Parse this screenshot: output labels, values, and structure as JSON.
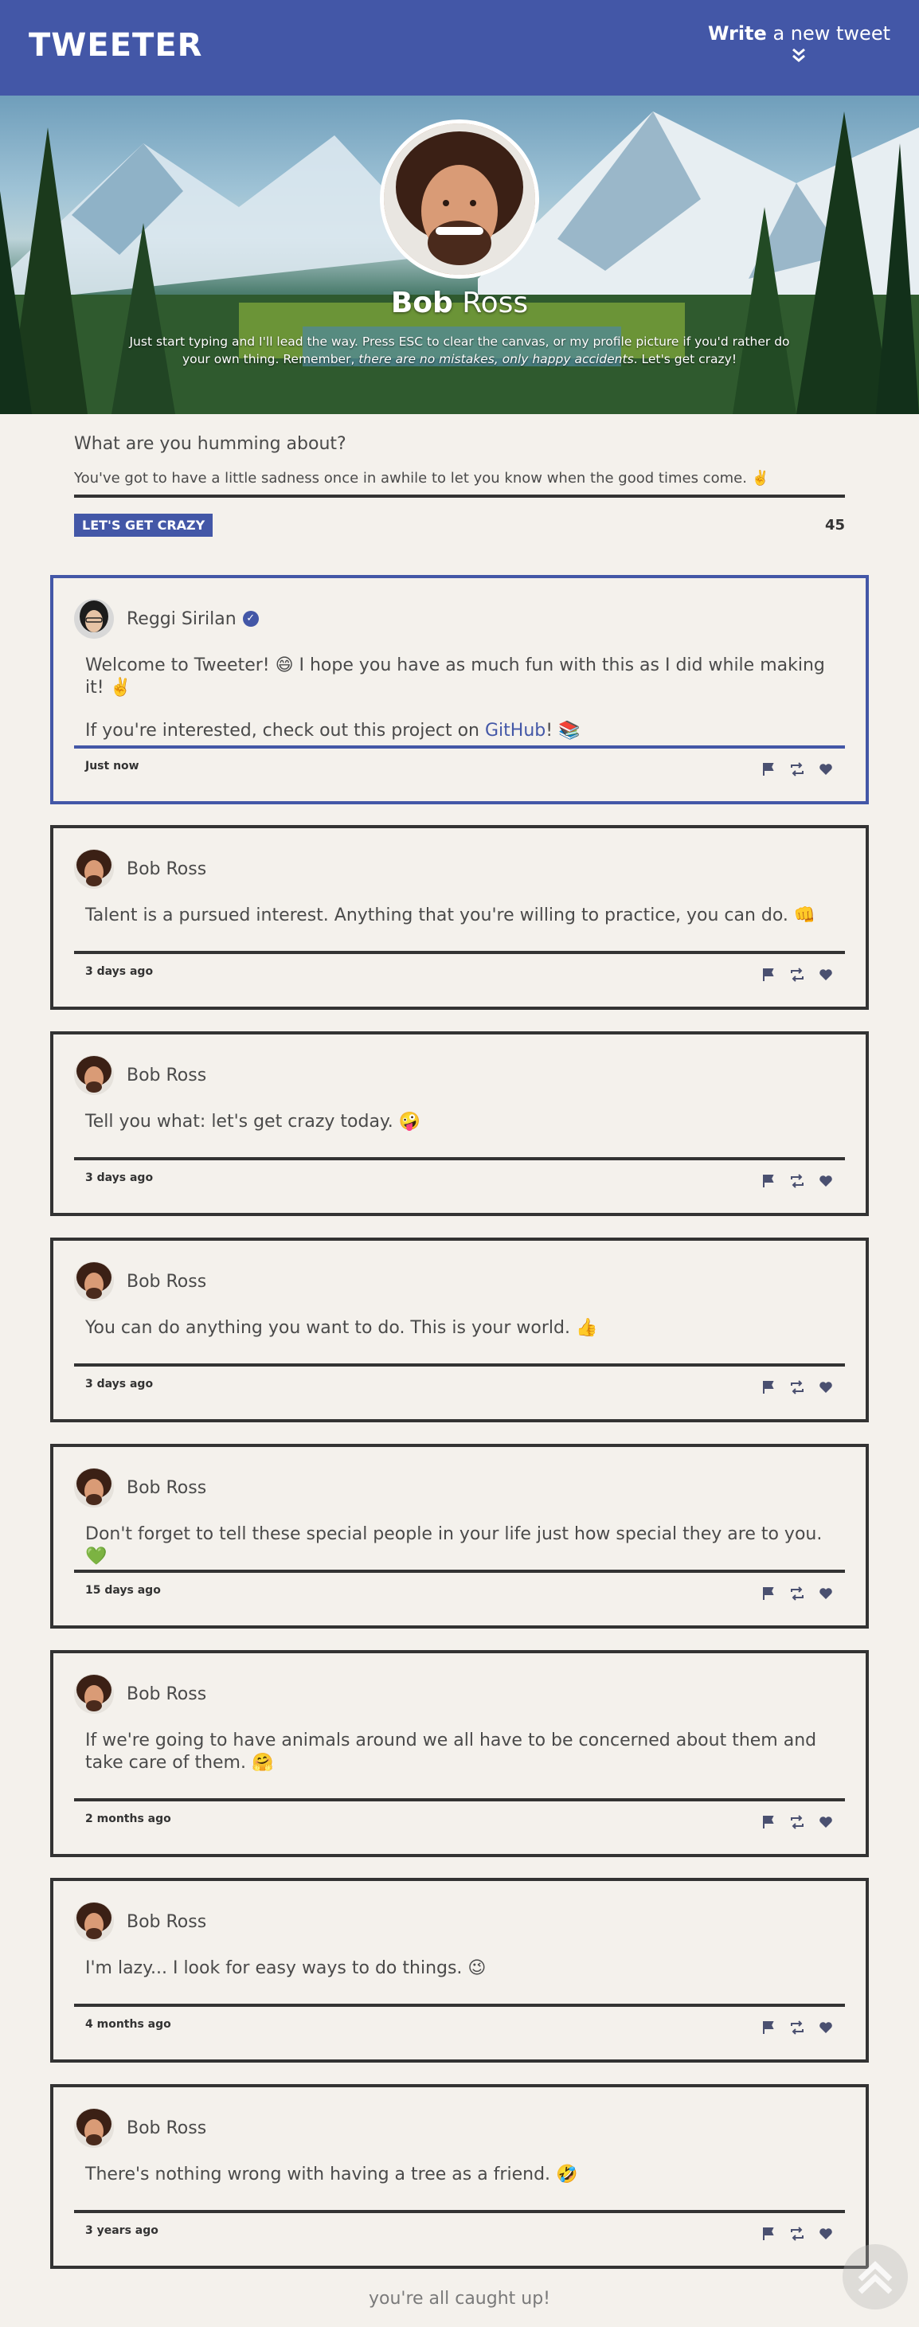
{
  "nav": {
    "logo": "TWEETER",
    "write_bold": "Write",
    "write_rest": " a new tweet",
    "chevron": "»"
  },
  "profile": {
    "first_name": "Bob",
    "last_name": " Ross",
    "desc_1": "Just start typing and I'll lead the way. Press ESC to clear the canvas, or my profile picture if you'd rather do your own thing. Remember, ",
    "desc_em": "there are no mistakes, only happy accidents",
    "desc_2": ". Let's get crazy!"
  },
  "compose": {
    "prompt": "What are you humming about?",
    "input": "You've got to have a little sadness once in awhile to let you know when the good times come. ✌️",
    "button": "LET'S GET CRAZY",
    "counter": "45"
  },
  "tweets": [
    {
      "author": "Reggi Sirilan",
      "verified": true,
      "line1": "Welcome to Tweeter! 😄 I hope you have as much fun with this as I did while making it! ✌️",
      "line2_pre": "If you're interested, check out this project on ",
      "line2_link": "GitHub",
      "line2_post": "! 📚",
      "time": "Just now"
    },
    {
      "author": "Bob Ross",
      "text": "Talent is a pursued interest. Anything that you're willing to practice, you can do. 👊",
      "time": "3 days ago"
    },
    {
      "author": "Bob Ross",
      "text": "Tell you what: let's get crazy today. 🤪",
      "time": "3 days ago"
    },
    {
      "author": "Bob Ross",
      "text": "You can do anything you want to do. This is your world. 👍",
      "time": "3 days ago"
    },
    {
      "author": "Bob Ross",
      "text": "Don't forget to tell these special people in your life just how special they are to you. 💚",
      "time": "15 days ago"
    },
    {
      "author": "Bob Ross",
      "text": "If we're going to have animals around we all have to be concerned about them and take care of them. 🤗",
      "time": "2 months ago"
    },
    {
      "author": "Bob Ross",
      "text": "I'm lazy... I look for easy ways to do things. 😉",
      "time": "4 months ago"
    },
    {
      "author": "Bob Ross",
      "text": "There's nothing wrong with having a tree as a friend. 🤣",
      "time": "3 years ago"
    }
  ],
  "footer": "you're all caught up!",
  "colors": {
    "primary": "#4357a7",
    "background": "#f4f1ec",
    "border": "#333333"
  },
  "icons": [
    "flag-icon",
    "retweet-icon",
    "heart-icon",
    "scroll-top-icon",
    "verified-icon"
  ]
}
